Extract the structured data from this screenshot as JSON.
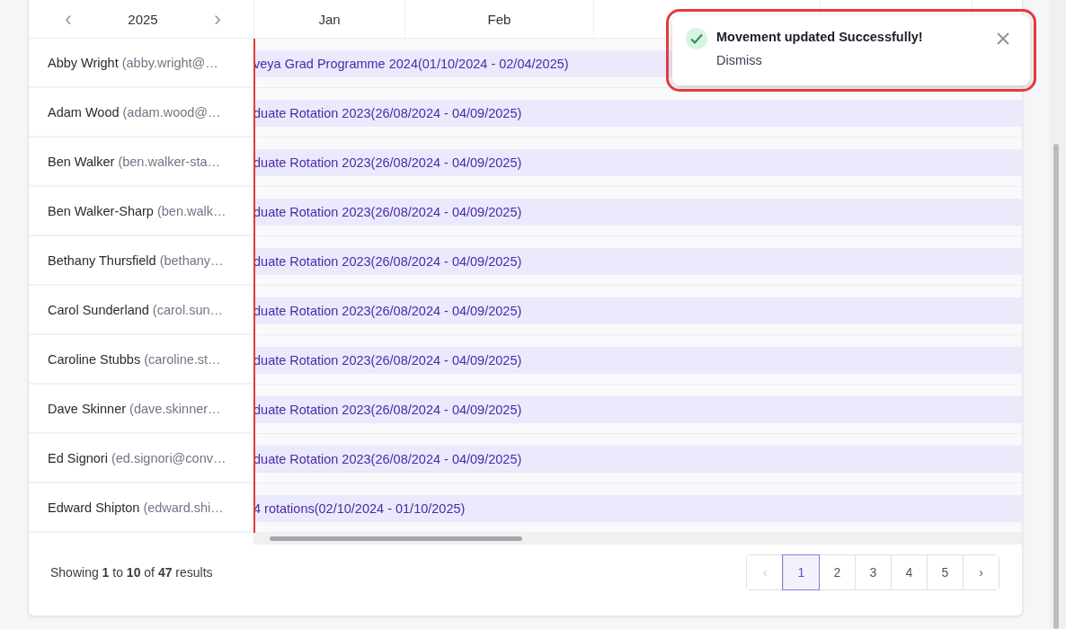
{
  "year_nav": {
    "prev": "‹",
    "year": "2025",
    "next": "›"
  },
  "months": [
    {
      "label": "Jan"
    },
    {
      "label": "Feb"
    }
  ],
  "rows": [
    {
      "name": "Abby Wright",
      "email": "(abby.wright@…",
      "bar": "veya Grad Programme 2024(01/10/2024 - 02/04/2025)"
    },
    {
      "name": "Adam Wood",
      "email": "(adam.wood@…",
      "bar": "duate Rotation 2023(26/08/2024 - 04/09/2025)"
    },
    {
      "name": "Ben Walker",
      "email": "(ben.walker-sta…",
      "bar": "duate Rotation 2023(26/08/2024 - 04/09/2025)"
    },
    {
      "name": "Ben Walker-Sharp",
      "email": "(ben.walk…",
      "bar": "duate Rotation 2023(26/08/2024 - 04/09/2025)"
    },
    {
      "name": "Bethany Thursfield",
      "email": "(bethany…",
      "bar": "duate Rotation 2023(26/08/2024 - 04/09/2025)"
    },
    {
      "name": "Carol Sunderland",
      "email": "(carol.sun…",
      "bar": "duate Rotation 2023(26/08/2024 - 04/09/2025)"
    },
    {
      "name": "Caroline Stubbs",
      "email": "(caroline.st…",
      "bar": "duate Rotation 2023(26/08/2024 - 04/09/2025)"
    },
    {
      "name": "Dave Skinner",
      "email": "(dave.skinner…",
      "bar": "duate Rotation 2023(26/08/2024 - 04/09/2025)"
    },
    {
      "name": "Ed Signori",
      "email": "(ed.signori@conv…",
      "bar": "duate Rotation 2023(26/08/2024 - 04/09/2025)"
    },
    {
      "name": "Edward Shipton",
      "email": "(edward.shi…",
      "bar": "4 rotations(02/10/2024 - 01/10/2025)"
    }
  ],
  "footer": {
    "summary": "Showing **1** to **10** of **47** results"
  },
  "pagination": {
    "prev": "‹",
    "prev_disabled": true,
    "pages": [
      {
        "label": "1",
        "selected": true
      },
      {
        "label": "2",
        "selected": false
      },
      {
        "label": "3",
        "selected": false
      },
      {
        "label": "4",
        "selected": false
      },
      {
        "label": "5",
        "selected": false
      }
    ],
    "next": "›"
  },
  "toast": {
    "message": "Movement updated Successfully!",
    "action": "Dismiss",
    "highlighted": true
  }
}
